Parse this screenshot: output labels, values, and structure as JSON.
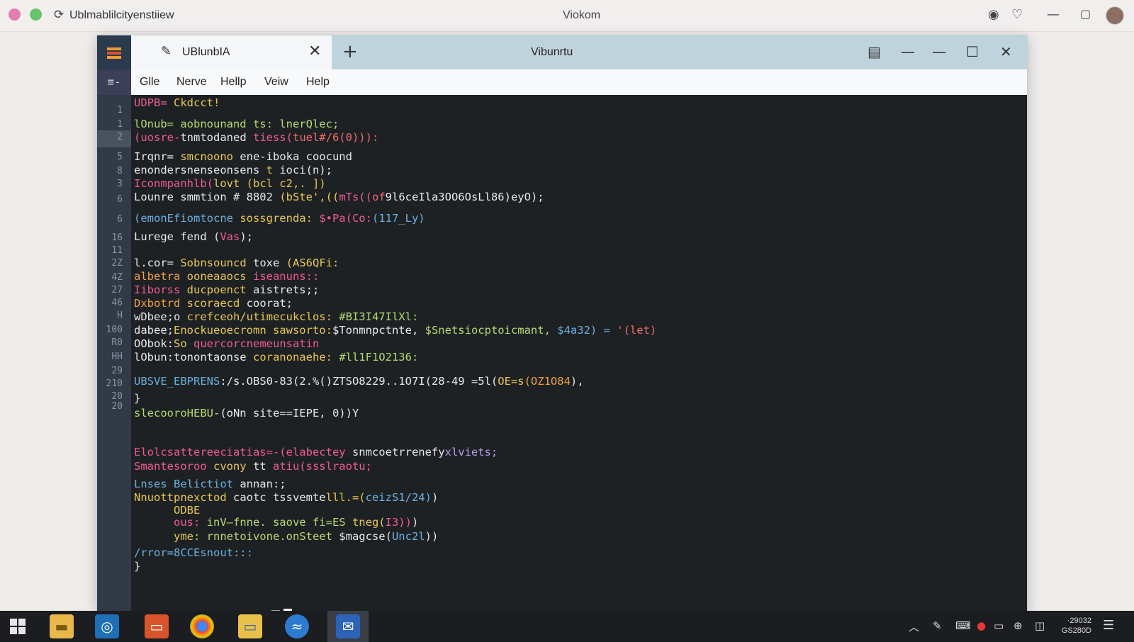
{
  "host": {
    "url": "Ublmablilcityenstiiew",
    "title": "Viokom",
    "refresh_icon": "⟳"
  },
  "window": {
    "tab_label": "UBlunbIA",
    "title": "Vibunrtu",
    "menu": [
      "Glle",
      "Nerve",
      "Hellp",
      "Veiw",
      "Help"
    ],
    "menu_side_icon": "≡-"
  },
  "editor": {
    "line_numbers": [
      "1",
      "1",
      "2",
      "5",
      "8",
      "3",
      "6",
      "6",
      "16",
      "11",
      "2Z",
      "4Z",
      "27",
      "46",
      "H",
      "100",
      "R0",
      "HH",
      "29",
      "210",
      "20",
      "20"
    ],
    "lines": [
      [
        {
          "t": "UDPB= ",
          "c": "p"
        },
        {
          "t": "Ckdcct!",
          "c": "y"
        }
      ],
      [
        {
          "t": "lOnub= aobnounand ts: lnerQlec;",
          "c": "g"
        }
      ],
      [
        {
          "t": "(uosre-",
          "c": "p"
        },
        {
          "t": "tnmtodaned ",
          "c": "w"
        },
        {
          "t": "tiess(",
          "c": "p"
        },
        {
          "t": "tuel#/6(0))):",
          "c": "r"
        }
      ],
      [
        {
          "t": "Irqnr= ",
          "c": "w"
        },
        {
          "t": "smcnoono ",
          "c": "y"
        },
        {
          "t": "ene-iboka coocund",
          "c": "w"
        }
      ],
      [
        {
          "t": "enondersnenseonsens ",
          "c": "w"
        },
        {
          "t": "t ",
          "c": "y"
        },
        {
          "t": "ioci(n);",
          "c": "w"
        }
      ],
      [
        {
          "t": "Iconmpanhlb(",
          "c": "p"
        },
        {
          "t": "lovt (bcl c2,. ])",
          "c": "y"
        }
      ],
      [
        {
          "t": "Lounre smmtion # 8802 ",
          "c": "w"
        },
        {
          "t": "(bSte',((",
          "c": "y"
        },
        {
          "t": "mTs((",
          "c": "p"
        },
        {
          "t": "of",
          "c": "r"
        },
        {
          "t": "9l6ceIla3OO6OsLl86)eyO);",
          "c": "w"
        }
      ],
      [
        {
          "t": "(emonEfiomtocne ",
          "c": "c"
        },
        {
          "t": "sossgrenda: ",
          "c": "y"
        },
        {
          "t": "$•Pa(Co:",
          "c": "p"
        },
        {
          "t": "(117_Ly)",
          "c": "c"
        }
      ],
      [
        {
          "t": "Lurege fend (",
          "c": "w"
        },
        {
          "t": "Vas",
          "c": "p"
        },
        {
          "t": ");",
          "c": "w"
        }
      ],
      [
        {
          "t": "l.cor= ",
          "c": "w"
        },
        {
          "t": "Sobnsouncd ",
          "c": "y"
        },
        {
          "t": "toxe ",
          "c": "w"
        },
        {
          "t": "(AS6QFi:",
          "c": "y"
        }
      ],
      [
        {
          "t": "albetra ",
          "c": "o"
        },
        {
          "t": "ooneaaocs ",
          "c": "y"
        },
        {
          "t": "iseanuns::",
          "c": "p"
        }
      ],
      [
        {
          "t": "Iiborss ",
          "c": "p"
        },
        {
          "t": "ducpoenct ",
          "c": "y"
        },
        {
          "t": "aistrets;;",
          "c": "w"
        }
      ],
      [
        {
          "t": "Dxbotrd ",
          "c": "o"
        },
        {
          "t": "scoraecd ",
          "c": "y"
        },
        {
          "t": "coorat;",
          "c": "w"
        }
      ],
      [
        {
          "t": "wDbee;o ",
          "c": "w"
        },
        {
          "t": "crefceoh/utimecukclos: ",
          "c": "y"
        },
        {
          "t": "#BI3I47IlXl:",
          "c": "g"
        }
      ],
      [
        {
          "t": "dabee;",
          "c": "w"
        },
        {
          "t": "Enockueoecromn sawsorto:",
          "c": "y"
        },
        {
          "t": "$Tonmnpctnte, ",
          "c": "w"
        },
        {
          "t": "$Snetsiocptoicmant, ",
          "c": "g"
        },
        {
          "t": "$4a32) = ",
          "c": "c"
        },
        {
          "t": "'(let)",
          "c": "r"
        }
      ],
      [
        {
          "t": "OObok:",
          "c": "w"
        },
        {
          "t": "So ",
          "c": "y"
        },
        {
          "t": "quercorcnemeunsatin",
          "c": "p"
        }
      ],
      [
        {
          "t": "lObun:tonontaonse ",
          "c": "w"
        },
        {
          "t": "coranonaehe: ",
          "c": "y"
        },
        {
          "t": "#ll1F1O2136:",
          "c": "g"
        }
      ],
      [
        {
          "t": "UBSVE_EBPRENS",
          "c": "c"
        },
        {
          "t": ":/s.OBS0-83(2.%()ZTSO8229..1O7I(28-49 =5l(",
          "c": "w"
        },
        {
          "t": "OE=s",
          "c": "y"
        },
        {
          "t": "(OZ1O84",
          "c": "o"
        },
        {
          "t": "),",
          "c": "w"
        }
      ],
      [
        {
          "t": "}",
          "c": "w"
        }
      ],
      [
        {
          "t": "slecooroHEBU",
          "c": "g"
        },
        {
          "t": "-(oNn site==IEPE, 0))Y",
          "c": "w"
        }
      ],
      [
        {
          "t": "Elolcsattereeciatias=-(elabectey ",
          "c": "p"
        },
        {
          "t": "snmcoetrrenefy",
          "c": "w"
        },
        {
          "t": "xlviets;",
          "c": "v"
        }
      ],
      [
        {
          "t": "Smantesoroo ",
          "c": "p"
        },
        {
          "t": "cvony ",
          "c": "y"
        },
        {
          "t": "tt ",
          "c": "w"
        },
        {
          "t": "atiu(ssslraotu;",
          "c": "p"
        }
      ],
      [
        {
          "t": "Lnses Belictiot ",
          "c": "c"
        },
        {
          "t": "annan:;",
          "c": "w"
        }
      ],
      [
        {
          "t": "Nnuottpnexctod ",
          "c": "y"
        },
        {
          "t": "caotc tssvemte",
          "c": "w"
        },
        {
          "t": "lll.=(",
          "c": "y"
        },
        {
          "t": "ceizS1/24)",
          "c": "c"
        },
        {
          "t": ")",
          "c": "w"
        }
      ],
      [
        {
          "t": "      ODBE",
          "c": "y"
        }
      ],
      [
        {
          "t": "      ous: ",
          "c": "p"
        },
        {
          "t": "inV—fnne. saove fi=ES ",
          "c": "g"
        },
        {
          "t": "tneg(",
          "c": "y"
        },
        {
          "t": "I3))",
          "c": "p"
        },
        {
          "t": ")",
          "c": "w"
        }
      ],
      [
        {
          "t": "      yme: ",
          "c": "y"
        },
        {
          "t": "rnnetoivone.onSteet ",
          "c": "g"
        },
        {
          "t": "$magcse(",
          "c": "w"
        },
        {
          "t": "Unc2l",
          "c": "c"
        },
        {
          "t": "))",
          "c": "w"
        }
      ],
      [
        {
          "t": "/rror=8CCEsnout::: ",
          "c": "c"
        }
      ],
      [
        {
          "t": "}",
          "c": "w"
        }
      ]
    ]
  },
  "taskbar": {
    "clock_line1": "·29032",
    "clock_line2": "GS280D"
  }
}
